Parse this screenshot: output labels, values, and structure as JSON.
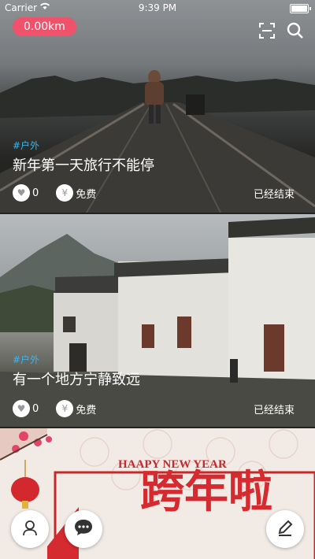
{
  "status_bar": {
    "carrier": "Carrier",
    "time": "9:39 PM"
  },
  "header": {
    "distance": "0.00km",
    "scan_icon": "scan-icon",
    "search_icon": "search-icon"
  },
  "cards": [
    {
      "tag": "#户外",
      "title": "新年第一天旅行不能停",
      "likes": "0",
      "price": "免费",
      "status": "已经结束",
      "like_symbol": "♥",
      "price_symbol": "¥"
    },
    {
      "tag": "#户外",
      "title": "有一个地方宁静致远",
      "likes": "0",
      "price": "免费",
      "status": "已经结束",
      "like_symbol": "♥",
      "price_symbol": "¥"
    },
    {
      "banner_text": "HAAPY NEW YEAR",
      "banner_big": "跨年啦"
    }
  ],
  "colors": {
    "accent": "#f0526b",
    "tag": "#35b8f0"
  }
}
